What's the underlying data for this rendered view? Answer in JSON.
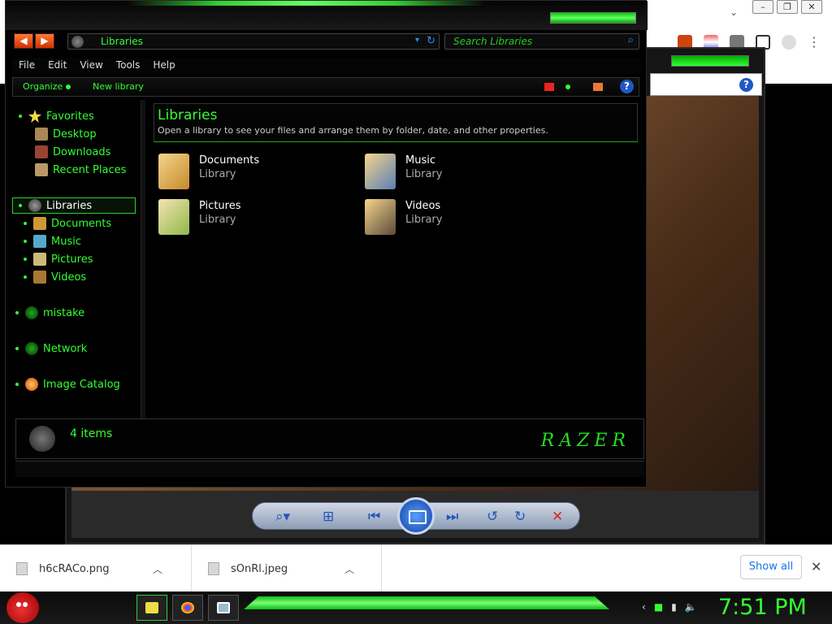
{
  "explorer": {
    "address": "Libraries",
    "search_placeholder": "Search Libraries",
    "menu": [
      "File",
      "Edit",
      "View",
      "Tools",
      "Help"
    ],
    "commands": {
      "organize": "Organize",
      "new_library": "New library"
    },
    "nav": {
      "favorites": "Favorites",
      "desktop": "Desktop",
      "downloads": "Downloads",
      "recent_places": "Recent Places",
      "libraries": "Libraries",
      "documents": "Documents",
      "music": "Music",
      "pictures": "Pictures",
      "videos": "Videos",
      "mistake": "mistake",
      "network": "Network",
      "image_catalog": "Image Catalog"
    },
    "header": {
      "title": "Libraries",
      "subtitle": "Open a library to see your files and arrange them by folder, date, and other properties."
    },
    "libraries": [
      {
        "name": "Documents",
        "kind": "Library"
      },
      {
        "name": "Music",
        "kind": "Library"
      },
      {
        "name": "Pictures",
        "kind": "Library"
      },
      {
        "name": "Videos",
        "kind": "Library"
      }
    ],
    "item_count": "4 items",
    "brand_logo": "RAZER"
  },
  "downloads": [
    {
      "name": "h6cRACo.png"
    },
    {
      "name": "sOnRl.jpeg"
    }
  ],
  "show_all": "Show all",
  "taskbar": {
    "clock": "7:51 PM"
  },
  "colors": {
    "accent": "#33ff33",
    "background": "#000000",
    "link_blue": "#1a73e8"
  }
}
